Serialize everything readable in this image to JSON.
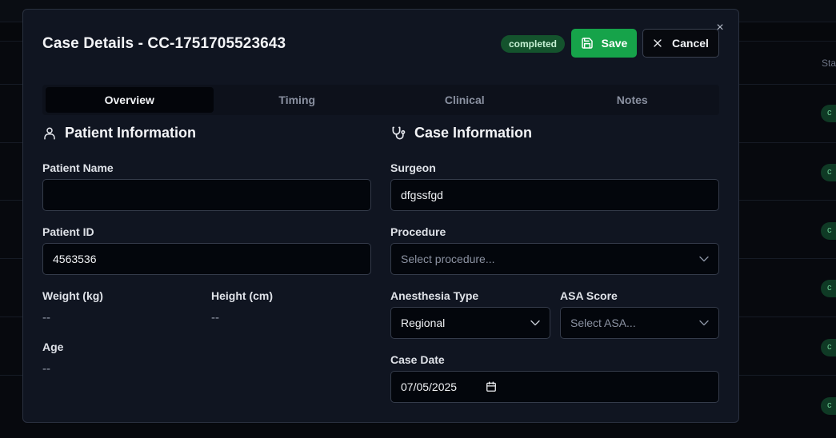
{
  "background": {
    "column_header": "Sta",
    "status_pill_text": "c",
    "row_count": 6
  },
  "modal": {
    "title": "Case Details - CC-1751705523643",
    "status_badge": "completed",
    "save_label": "Save",
    "cancel_label": "Cancel",
    "close_symbol": "×"
  },
  "tabs": [
    {
      "label": "Overview",
      "active": true
    },
    {
      "label": "Timing",
      "active": false
    },
    {
      "label": "Clinical",
      "active": false
    },
    {
      "label": "Notes",
      "active": false
    }
  ],
  "patient": {
    "section_title": "Patient Information",
    "section_icon": "user-icon",
    "name_label": "Patient Name",
    "name_value": "",
    "id_label": "Patient ID",
    "id_value": "4563536",
    "weight_label": "Weight (kg)",
    "weight_value": "--",
    "height_label": "Height (cm)",
    "height_value": "--",
    "age_label": "Age",
    "age_value": "--"
  },
  "case": {
    "section_title": "Case Information",
    "section_icon": "stethoscope-icon",
    "surgeon_label": "Surgeon",
    "surgeon_value": "dfgssfgd",
    "procedure_label": "Procedure",
    "procedure_placeholder": "Select procedure...",
    "anesthesia_label": "Anesthesia Type",
    "anesthesia_value": "Regional",
    "asa_label": "ASA Score",
    "asa_placeholder": "Select ASA...",
    "date_label": "Case Date",
    "date_value": "07/05/2025"
  },
  "colors": {
    "accent_green": "#16a34a",
    "badge_bg": "#14532d",
    "modal_bg": "#101521"
  }
}
